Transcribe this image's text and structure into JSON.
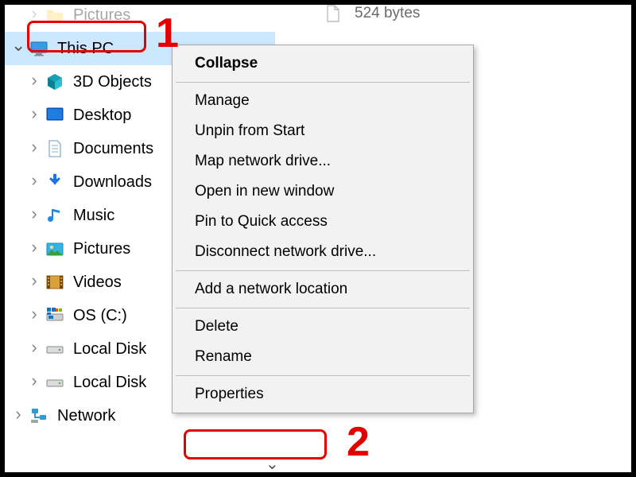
{
  "file_row": {
    "size": "524 bytes"
  },
  "tree": {
    "pictures_top": "Pictures",
    "this_pc": "This PC",
    "children": [
      {
        "label": "3D Objects"
      },
      {
        "label": "Desktop"
      },
      {
        "label": "Documents"
      },
      {
        "label": "Downloads"
      },
      {
        "label": "Music"
      },
      {
        "label": "Pictures"
      },
      {
        "label": "Videos"
      },
      {
        "label": "OS (C:)"
      },
      {
        "label": "Local Disk"
      },
      {
        "label": "Local Disk"
      }
    ],
    "network": "Network"
  },
  "menu": {
    "collapse": "Collapse",
    "manage": "Manage",
    "unpin": "Unpin from Start",
    "map_drive": "Map network drive...",
    "open_new": "Open in new window",
    "pin_quick": "Pin to Quick access",
    "disconnect": "Disconnect network drive...",
    "add_location": "Add a network location",
    "delete": "Delete",
    "rename": "Rename",
    "properties": "Properties"
  },
  "callouts": {
    "one": "1",
    "two": "2"
  }
}
